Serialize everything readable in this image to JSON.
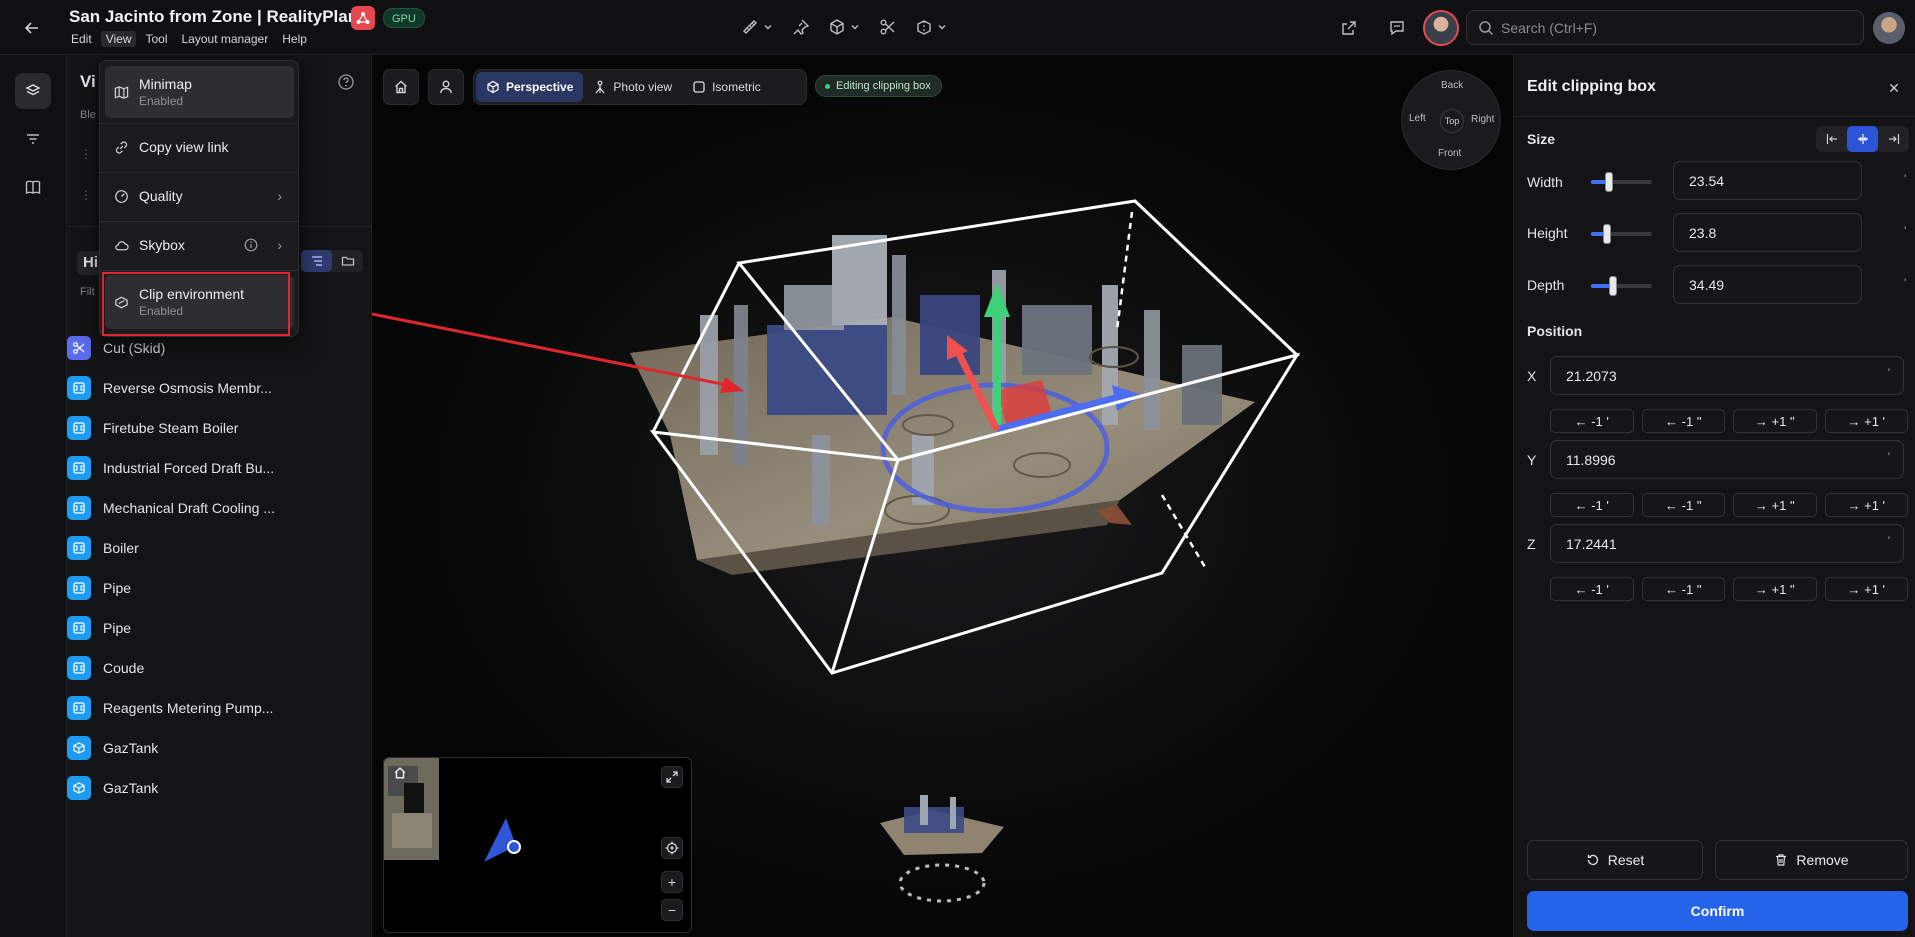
{
  "header": {
    "title": "San Jacinto from Zone | RealityPlan",
    "gpu_badge": "GPU",
    "menus": [
      "Edit",
      "View",
      "Tool",
      "Layout manager",
      "Help"
    ],
    "search_placeholder": "Search (Ctrl+F)"
  },
  "left_panel": {
    "title": "Vi",
    "subtitle": "Ble",
    "hierarchy_heading": "Hi",
    "filter_label": "Filt",
    "items": [
      {
        "label": "Cut (Skid)",
        "icon": "cut-skid-icon"
      },
      {
        "label": "Reverse Osmosis Membr...",
        "icon": "component-icon"
      },
      {
        "label": "Firetube Steam Boiler",
        "icon": "component-icon"
      },
      {
        "label": "Industrial Forced Draft Bu...",
        "icon": "component-icon"
      },
      {
        "label": "Mechanical Draft Cooling ...",
        "icon": "component-icon"
      },
      {
        "label": "Boiler",
        "icon": "component-icon"
      },
      {
        "label": "Pipe",
        "icon": "component-icon"
      },
      {
        "label": "Pipe",
        "icon": "component-icon"
      },
      {
        "label": "Coude",
        "icon": "component-icon"
      },
      {
        "label": "Reagents Metering Pump...",
        "icon": "component-icon"
      },
      {
        "label": "GazTank",
        "icon": "tank-icon"
      },
      {
        "label": "GazTank",
        "icon": "tank-icon"
      }
    ]
  },
  "view_menu": {
    "minimap": {
      "label": "Minimap",
      "sub": "Enabled"
    },
    "copy_link": {
      "label": "Copy view link"
    },
    "quality": {
      "label": "Quality"
    },
    "skybox": {
      "label": "Skybox"
    },
    "clip": {
      "label": "Clip environment",
      "sub": "Enabled"
    }
  },
  "viewport": {
    "modes": {
      "perspective": "Perspective",
      "photo": "Photo view",
      "isometric": "Isometric"
    },
    "editing_badge": "Editing clipping box",
    "navcube": {
      "back": "Back",
      "left": "Left",
      "top": "Top",
      "right": "Right",
      "front": "Front"
    }
  },
  "clip_panel": {
    "title": "Edit clipping box",
    "size_label": "Size",
    "width_label": "Width",
    "width_value": "23.54",
    "height_label": "Height",
    "height_value": "23.8",
    "depth_label": "Depth",
    "depth_value": "34.49",
    "size_unit": "'",
    "slider_levels": {
      "width": 0.3,
      "height": 0.27,
      "depth": 0.36
    },
    "position_label": "Position",
    "x_label": "X",
    "x_value": "21.2073",
    "y_label": "Y",
    "y_value": "11.8996",
    "z_label": "Z",
    "z_value": "17.2441",
    "pos_unit": "'",
    "steps": [
      "← -1 '",
      "← -1 \"",
      "→ +1 \"",
      "→ +1 '"
    ],
    "reset": "Reset",
    "remove": "Remove",
    "confirm": "Confirm"
  },
  "colors": {
    "accent": "#2563eb",
    "highlight_red": "#e0262c",
    "brand": "#e5484d"
  }
}
